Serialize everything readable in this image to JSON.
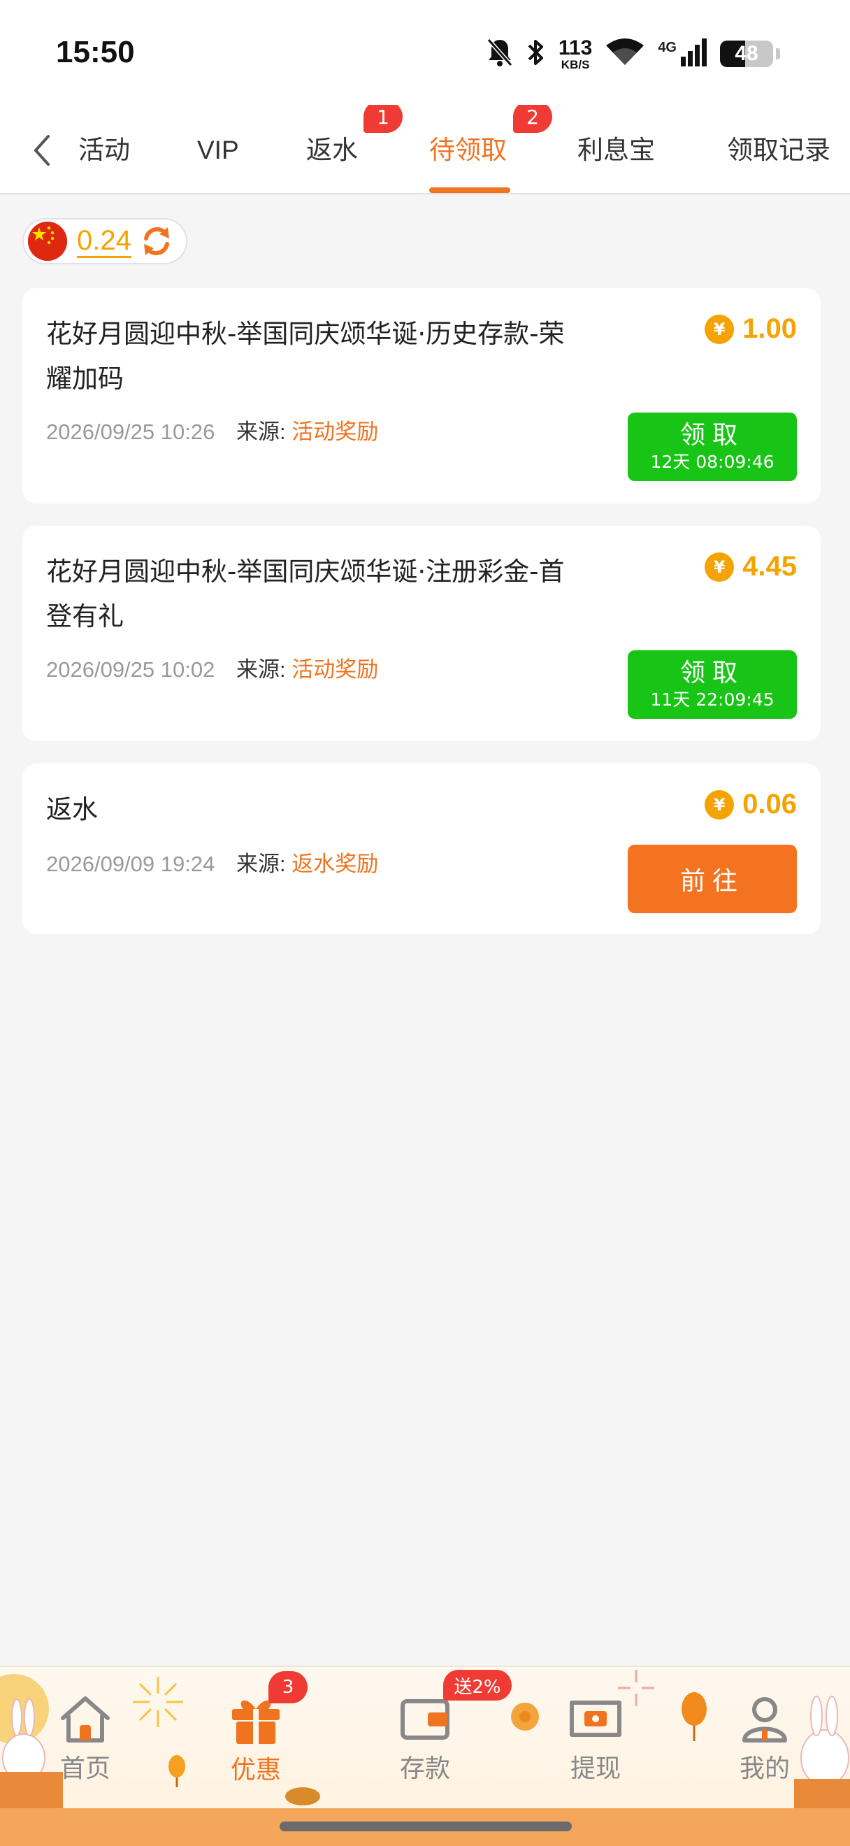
{
  "status_bar": {
    "time": "15:50",
    "net_speed": "113",
    "net_unit": "KB/S",
    "network": "4G",
    "battery": "48",
    "icons": [
      "bell-muted-icon",
      "bluetooth-icon",
      "wifi-icon",
      "signal-icon",
      "battery-icon"
    ]
  },
  "tabs": [
    {
      "label": "活动",
      "active": false
    },
    {
      "label": "VIP",
      "active": false
    },
    {
      "label": "返水",
      "badge": "1",
      "active": false
    },
    {
      "label": "待领取",
      "badge": "2",
      "active": true
    },
    {
      "label": "利息宝",
      "active": false
    },
    {
      "label": "领取记录",
      "active": false
    }
  ],
  "balance": {
    "value": "0.24",
    "flag": "china-flag-icon",
    "refresh": "refresh-icon"
  },
  "records": [
    {
      "title": "花好月圆迎中秋-举国同庆颂华诞·历史存款-荣耀加码",
      "amount": "1.00",
      "time": "2026/09/25 10:26",
      "source_label": "来源:",
      "source": "活动奖励",
      "button_label": "领取",
      "countdown": "12天 08:09:46"
    },
    {
      "title": "花好月圆迎中秋-举国同庆颂华诞·注册彩金-首登有礼",
      "amount": "4.45",
      "time": "2026/09/25 10:02",
      "source_label": "来源:",
      "source": "活动奖励",
      "button_label": "领取",
      "countdown": "11天 22:09:45"
    },
    {
      "title": "返水",
      "amount": "0.06",
      "time": "2026/09/09 19:24",
      "source_label": "来源:",
      "source": "返水奖励",
      "button_label": "前往"
    }
  ],
  "coin_symbol": "¥",
  "bottom_nav": [
    {
      "label": "首页",
      "icon": "home-icon",
      "active": false
    },
    {
      "label": "优惠",
      "icon": "gift-icon",
      "badge": "3",
      "active": true
    },
    {
      "label": "存款",
      "icon": "wallet-icon",
      "badge": "送2%",
      "active": false
    },
    {
      "label": "提现",
      "icon": "withdraw-icon",
      "active": false
    },
    {
      "label": "我的",
      "icon": "profile-icon",
      "active": false
    }
  ],
  "colors": {
    "accent": "#f07320",
    "gold": "#f5a300",
    "claim_green": "#18c416",
    "badge_red": "#ef3b33"
  }
}
